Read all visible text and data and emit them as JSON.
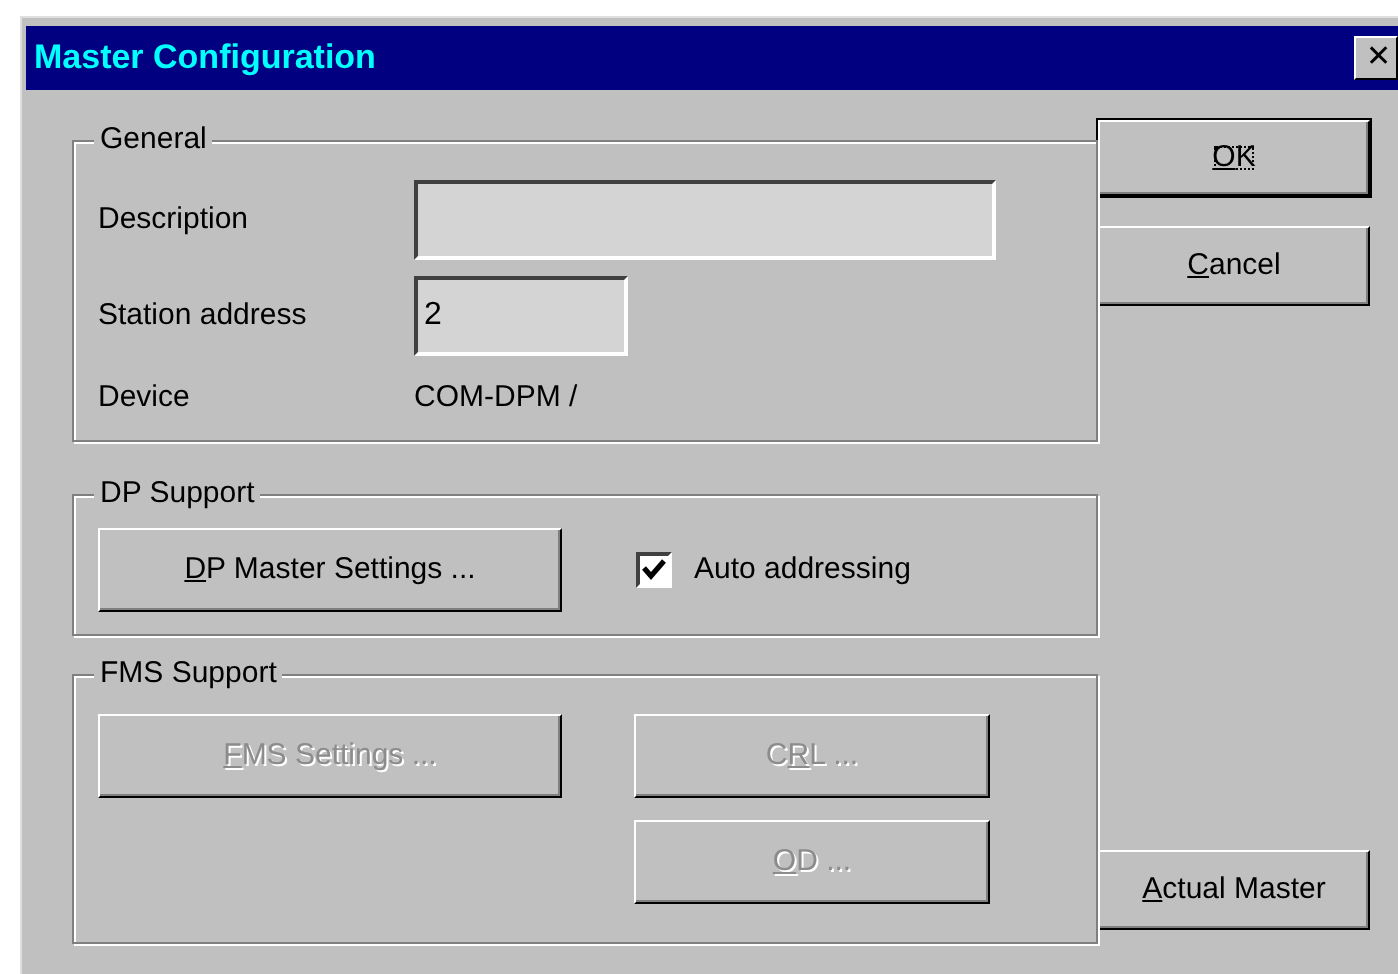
{
  "window": {
    "title": "Master Configuration",
    "close": "✕"
  },
  "general": {
    "title": "General",
    "fields": [
      {
        "label": "Description",
        "kind": "wide"
      },
      {
        "label": "Station address",
        "value": "2",
        "kind": "narrow"
      }
    ],
    "device": {
      "label": "Device",
      "value": "COM-DPM /"
    }
  },
  "dp_support": {
    "title": "DP Support",
    "button": {
      "label": [
        {
          "text": "D",
          "underline": true
        },
        {
          "text": "P Master Settings ...",
          "underline": false
        }
      ],
      "disabled": false
    },
    "checkbox": {
      "label": "Auto addressing",
      "checked": true
    }
  },
  "fms_support": {
    "title": "FMS Support",
    "buttons": [
      {
        "label": [
          {
            "text": "F",
            "underline": true
          },
          {
            "text": "MS Settings ...",
            "underline": false
          }
        ],
        "disabled": true
      },
      {
        "label": [
          {
            "text": "C",
            "underline": false
          },
          {
            "text": "R",
            "underline": true
          },
          {
            "text": "L ...",
            "underline": false
          }
        ],
        "disabled": true
      },
      {
        "label": [
          {
            "text": "O",
            "underline": true
          },
          {
            "text": "D ...",
            "underline": false
          }
        ],
        "disabled": true
      }
    ]
  },
  "side_buttons": [
    {
      "label": [
        {
          "text": "O",
          "underline": true
        },
        {
          "text": "K",
          "underline": false
        }
      ],
      "default": true,
      "disabled": false
    },
    {
      "label": [
        {
          "text": "C",
          "underline": true
        },
        {
          "text": "ancel",
          "underline": false
        }
      ],
      "default": false,
      "disabled": false
    },
    {
      "label": [
        {
          "text": "A",
          "underline": true
        },
        {
          "text": "ctual Master",
          "underline": false
        }
      ],
      "default": false,
      "disabled": false
    }
  ]
}
